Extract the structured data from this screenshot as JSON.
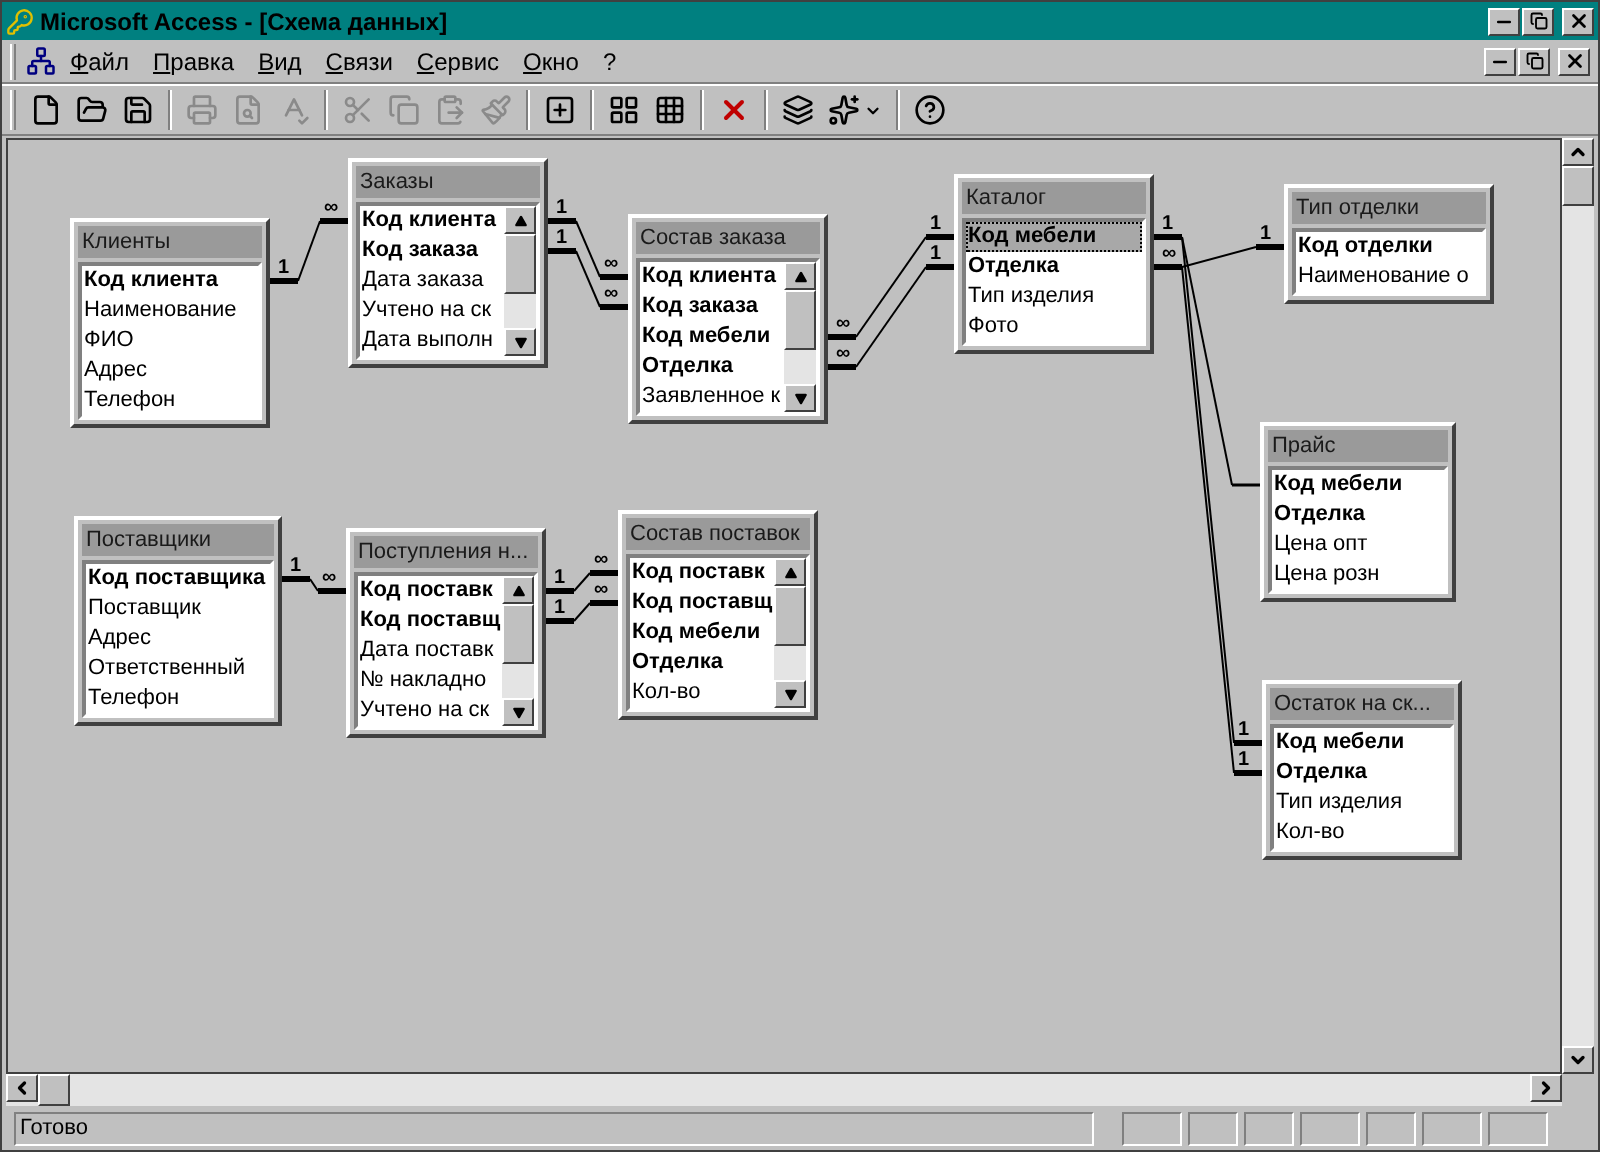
{
  "window": {
    "title": "Microsoft Access - [Схема данных]"
  },
  "menu": [
    {
      "label": "Файл"
    },
    {
      "label": "Правка"
    },
    {
      "label": "Вид"
    },
    {
      "label": "Связи"
    },
    {
      "label": "Сервис"
    },
    {
      "label": "Окно"
    },
    {
      "label": "?"
    }
  ],
  "toolbar": [
    {
      "kind": "new",
      "disabled": false
    },
    {
      "kind": "open",
      "disabled": false
    },
    {
      "kind": "save",
      "disabled": false
    },
    {
      "kind": "print",
      "disabled": true
    },
    {
      "kind": "preview",
      "disabled": true
    },
    {
      "kind": "spelling",
      "disabled": true
    },
    {
      "kind": "cut",
      "disabled": true
    },
    {
      "kind": "copy",
      "disabled": true
    },
    {
      "kind": "paste",
      "disabled": true
    },
    {
      "kind": "painter",
      "disabled": true
    },
    {
      "kind": "show_table",
      "disabled": false
    },
    {
      "kind": "direct",
      "disabled": false
    },
    {
      "kind": "all",
      "disabled": false
    },
    {
      "kind": "delete",
      "disabled": false
    },
    {
      "kind": "database_window",
      "disabled": false
    },
    {
      "kind": "new_object",
      "disabled": false
    },
    {
      "kind": "help",
      "disabled": false
    }
  ],
  "tables": [
    {
      "title": "Клиенты",
      "scrollbar": false,
      "fields": [
        {
          "name": "Код клиента",
          "key": true,
          "selected": false
        },
        {
          "name": "Наименование",
          "key": false,
          "selected": false
        },
        {
          "name": "ФИО",
          "key": false,
          "selected": false
        },
        {
          "name": "Адрес",
          "key": false,
          "selected": false
        },
        {
          "name": "Телефон",
          "key": false,
          "selected": false
        }
      ]
    },
    {
      "title": "Заказы",
      "scrollbar": true,
      "fields": [
        {
          "name": "Код клиента",
          "key": true,
          "selected": false
        },
        {
          "name": "Код заказа",
          "key": true,
          "selected": false
        },
        {
          "name": "Дата заказа",
          "key": false,
          "selected": false
        },
        {
          "name": "Учтено на ск",
          "key": false,
          "selected": false
        },
        {
          "name": "Дата выполн",
          "key": false,
          "selected": false
        }
      ]
    },
    {
      "title": "Состав заказа",
      "scrollbar": true,
      "fields": [
        {
          "name": "Код клиента",
          "key": true,
          "selected": false
        },
        {
          "name": "Код заказа",
          "key": true,
          "selected": false
        },
        {
          "name": "Код мебели",
          "key": true,
          "selected": false
        },
        {
          "name": "Отделка",
          "key": true,
          "selected": false
        },
        {
          "name": "Заявленное к",
          "key": false,
          "selected": false
        }
      ]
    },
    {
      "title": "Каталог",
      "scrollbar": false,
      "fields": [
        {
          "name": "Код мебели",
          "key": true,
          "selected": true
        },
        {
          "name": "Отделка",
          "key": true,
          "selected": false
        },
        {
          "name": "Тип изделия",
          "key": false,
          "selected": false
        },
        {
          "name": "Фото",
          "key": false,
          "selected": false
        }
      ]
    },
    {
      "title": "Тип отделки",
      "scrollbar": false,
      "fields": [
        {
          "name": "Код отделки",
          "key": true,
          "selected": false
        },
        {
          "name": "Наименование о",
          "key": false,
          "selected": false
        }
      ]
    },
    {
      "title": "Поставщики",
      "scrollbar": false,
      "fields": [
        {
          "name": "Код поставщика",
          "key": true,
          "selected": false
        },
        {
          "name": "Поставщик",
          "key": false,
          "selected": false
        },
        {
          "name": "Адрес",
          "key": false,
          "selected": false
        },
        {
          "name": "Ответственный",
          "key": false,
          "selected": false
        },
        {
          "name": "Телефон",
          "key": false,
          "selected": false
        }
      ]
    },
    {
      "title": "Поступления н...",
      "scrollbar": true,
      "fields": [
        {
          "name": "Код поставк",
          "key": true,
          "selected": false
        },
        {
          "name": "Код поставщ",
          "key": true,
          "selected": false
        },
        {
          "name": "Дата поставк",
          "key": false,
          "selected": false
        },
        {
          "name": "№ накладно",
          "key": false,
          "selected": false
        },
        {
          "name": "Учтено на ск",
          "key": false,
          "selected": false
        }
      ]
    },
    {
      "title": "Состав поставок",
      "scrollbar": true,
      "fields": [
        {
          "name": "Код поставк",
          "key": true,
          "selected": false
        },
        {
          "name": "Код поставщ",
          "key": true,
          "selected": false
        },
        {
          "name": "Код мебели",
          "key": true,
          "selected": false
        },
        {
          "name": "Отделка",
          "key": true,
          "selected": false
        },
        {
          "name": "Кол-во",
          "key": false,
          "selected": false
        }
      ]
    },
    {
      "title": "Прайс",
      "scrollbar": false,
      "fields": [
        {
          "name": "Код мебели",
          "key": true,
          "selected": false
        },
        {
          "name": "Отделка",
          "key": true,
          "selected": false
        },
        {
          "name": "Цена опт",
          "key": false,
          "selected": false
        },
        {
          "name": "Цена розн",
          "key": false,
          "selected": false
        }
      ]
    },
    {
      "title": "Остаток на ск...",
      "scrollbar": false,
      "fields": [
        {
          "name": "Код мебели",
          "key": true,
          "selected": false
        },
        {
          "name": "Отделка",
          "key": true,
          "selected": false
        },
        {
          "name": "Тип изделия",
          "key": false,
          "selected": false
        },
        {
          "name": "Кол-во",
          "key": false,
          "selected": false
        }
      ]
    }
  ],
  "relationships": [
    {
      "kind": "joined",
      "start_label": "1",
      "end_label": "∞"
    },
    {
      "kind": "joined",
      "start_label": "1",
      "end_label": "∞"
    },
    {
      "kind": "joined",
      "start_label": "1",
      "end_label": "∞"
    },
    {
      "kind": "joined",
      "start_label": "∞",
      "end_label": "1"
    },
    {
      "kind": "joined",
      "start_label": "∞",
      "end_label": "1"
    },
    {
      "kind": "joined",
      "start_label": "∞",
      "end_label": "1"
    },
    {
      "kind": "joined",
      "start_label": "1",
      "end_label": "1"
    },
    {
      "kind": "joined",
      "end_label": "1"
    },
    {
      "kind": "plain"
    },
    {
      "kind": "joined",
      "start_label": "1",
      "end_label": "∞"
    },
    {
      "kind": "joined",
      "start_label": "1",
      "end_label": "∞"
    },
    {
      "kind": "joined",
      "start_label": "1",
      "end_label": "∞"
    }
  ],
  "status_bar": {
    "text": "Готово"
  }
}
